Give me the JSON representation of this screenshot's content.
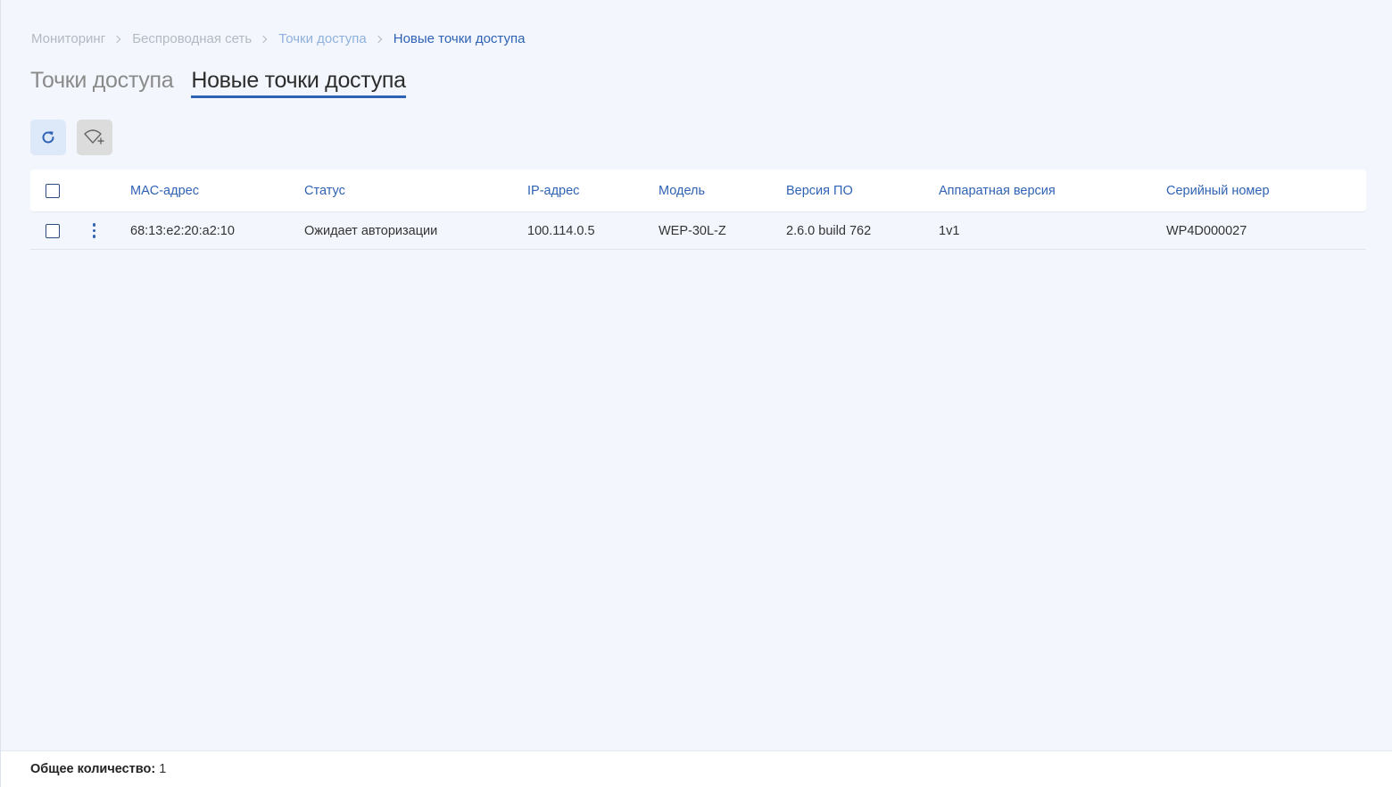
{
  "breadcrumb": [
    {
      "label": "Мониторинг"
    },
    {
      "label": "Беспроводная сеть"
    },
    {
      "label": "Точки доступа"
    },
    {
      "label": "Новые точки доступа"
    }
  ],
  "tabs": [
    {
      "label": "Точки доступа",
      "active": false
    },
    {
      "label": "Новые точки доступа",
      "active": true
    }
  ],
  "toolbar": {
    "refresh_icon": "refresh-icon",
    "add_ap_icon": "wifi-add-icon"
  },
  "table": {
    "columns": [
      "MAC-адрес",
      "Статус",
      "IP-адрес",
      "Модель",
      "Версия ПО",
      "Аппаратная версия",
      "Серийный номер"
    ],
    "rows": [
      [
        "68:13:e2:20:a2:10",
        "Ожидает авторизации",
        "100.114.0.5",
        "WEP-30L-Z",
        "2.6.0 build 762",
        "1v1",
        "WP4D000027"
      ]
    ]
  },
  "footer": {
    "total_label": "Общее количество:",
    "total_value": "1"
  },
  "colors": {
    "accent": "#2f62b4",
    "background": "#f3f7fd"
  }
}
